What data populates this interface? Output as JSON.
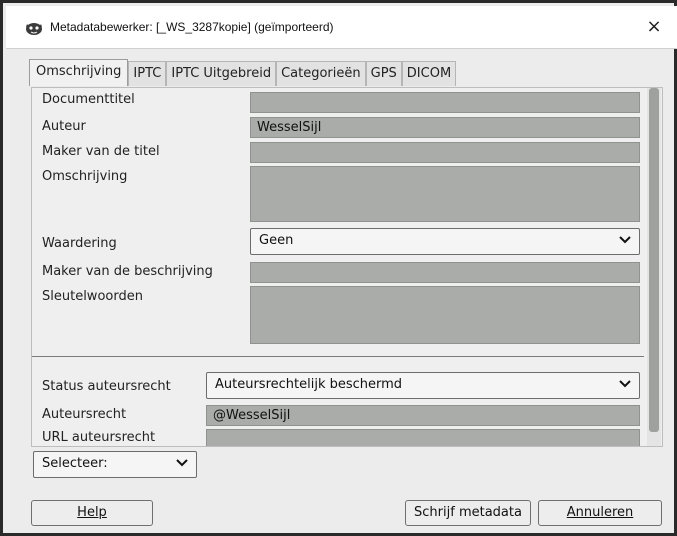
{
  "window": {
    "title": "Metadatabewerker: [_WS_3287kopie] (geïmporteerd)",
    "close_icon": "×"
  },
  "tabs": [
    {
      "label": "Omschrijving",
      "active": true
    },
    {
      "label": "IPTC",
      "active": false
    },
    {
      "label": "IPTC Uitgebreid",
      "active": false
    },
    {
      "label": "Categorieën",
      "active": false
    },
    {
      "label": "GPS",
      "active": false
    },
    {
      "label": "DICOM",
      "active": false
    }
  ],
  "form": {
    "documenttitel": {
      "label": "Documenttitel",
      "value": ""
    },
    "auteur": {
      "label": "Auteur",
      "value": "WesselSijl"
    },
    "maker_titel": {
      "label": "Maker van de titel",
      "value": ""
    },
    "omschrijving": {
      "label": "Omschrijving",
      "value": ""
    },
    "waardering": {
      "label": "Waardering",
      "value": "Geen"
    },
    "maker_beschrijving": {
      "label": "Maker van de beschrijving",
      "value": ""
    },
    "sleutelwoorden": {
      "label": "Sleutelwoorden",
      "value": ""
    },
    "status_auteursrecht": {
      "label": "Status auteursrecht",
      "value": "Auteursrechtelijk beschermd"
    },
    "auteursrecht": {
      "label": "Auteursrecht",
      "value": "@WesselSijl"
    },
    "url_auteursrecht": {
      "label": "URL auteursrecht",
      "value": ""
    }
  },
  "footer": {
    "select_label": "Selecteer:",
    "help_label": "Help",
    "write_label": "Schrijf metadata",
    "cancel_label": "Annuleren"
  },
  "colors": {
    "field_bg": "#a9aca8",
    "panel_bg": "#efefef"
  }
}
